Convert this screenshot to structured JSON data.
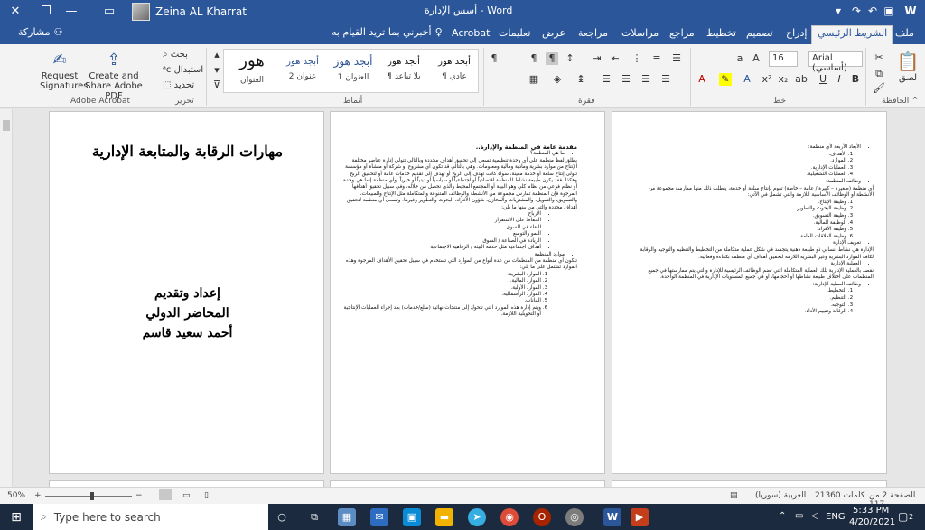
{
  "titlebar": {
    "doc_title": "أسس الإدارة  -  Word",
    "user_name": "Zeina AL Kharrat"
  },
  "tabs": {
    "items": [
      "ملف",
      "الشريط الرئيسي",
      "إدراج",
      "تصميم",
      "تخطيط",
      "مراجع",
      "مراسلات",
      "مراجعة",
      "عرض",
      "تعليمات",
      "Acrobat"
    ],
    "tell_me": "أخبرني بما تريد القيام به",
    "share": "مشاركة"
  },
  "ribbon": {
    "groups": {
      "clipboard": "الحافظة",
      "font": "خط",
      "paragraph": "فقرة",
      "styles": "أنماط",
      "editing": "تحرير",
      "acrobat": "Adobe Acrobat"
    },
    "paste": "لصق",
    "font_name": "Arial (أساسي)",
    "font_size": "16",
    "styles": [
      {
        "sample": "أبجد هوز",
        "name": "¶ عادي"
      },
      {
        "sample": "أبجد هوز",
        "name": "¶ بلا تباعد"
      },
      {
        "sample": "أبجد هوز",
        "name": "العنوان 1"
      },
      {
        "sample": "أبجد هوز",
        "name": "عنوان 2"
      },
      {
        "sample": "هور",
        "name": "العنوان"
      }
    ],
    "editing": {
      "find": "بحث",
      "replace": "استبدال",
      "select": "تحديد"
    },
    "acrobat": {
      "request": "Request Signatures",
      "create": "Create and Share Adobe PDF"
    }
  },
  "doc": {
    "cover_title": "مهارات الرقابة والمتابعة الإدارية",
    "cover_author": [
      "إعداد وتقديم",
      "المحاضر الدولي",
      "أحمد سعيد قاسم"
    ],
    "page2": {
      "heading": "مقدمة عامة في المنظمة والإدارة..",
      "q": "ما هي المنظمة؟",
      "para1": "يطلق لفظ منظمة على أي وحدة تنظيمية تسعى إلى تحقيق أهداف محددة وبالتالي تتولى إدارة عناصر مختلفة الإنتاج من موارد بشرية ومادية ومالية ومعلومات. وهي بالتالي قد تكون أي مشروع أو شركة أو منشأة أو مؤسسة تتولى إنتاج سلعة أو خدمة معينة، سواء كانت تهدف إلى الربح أو تهدف إلى تقديم خدمات عامة أو لتحقيق الربح وهكذا، فقد يكون طبيعة نشاط المنظمة اقتصادياً أو اجتماعياً أو سياسياً أو دينياً أو خيرياً. وأي منظمة إنما هي وحدة أو نظام فرعي من نظام كلي وهو البيئة أو المجتمع المحيط والذي تحصل من خلاله، وفي سبيل تحقيق أهدافها المرجوة فإن المنظمة تمارس مجموعة من الأنشطة والوظائف المتنوعة والمتكاملة مثل الإنتاج والمبيعات، والتسويق، والتمويل، والمشتريات والمخازن، شؤون الأفراد، البحوث والتطوير وغيرها. وتسعى أي منظمة لتحقيق أهداف محددة والتي من بينها ما يلي:",
      "goals": [
        "الأرباح",
        "الحفاظ على الاستقرار",
        "البقاء في السوق",
        "النمو والتوسع",
        "الريادة في الصناعة / السوق",
        "أهداف اجتماعية مثل خدمة البيئة / الرفاهية الاجتماعية"
      ],
      "resources_head": "موارد المنظمة",
      "resources_para": "تتكون أي منظمة من المنظمات من عدة أنواع من الموارد التي تستخدم في سبيل تحقيق الأهداف المرجوة وهذه الموارد تشتمل على ما يلي:",
      "resources": [
        "الموارد البشرية.",
        "الموارد المالية.",
        "الموارد الأولية.",
        "الموارد الرأسمالية.",
        "البيانات.",
        "ويتم إدارة هذه الموارد التي تتحول إلى منتجات نهائية (سلع/خدمات) بعد إجراء العمليات الإنتاجية أو التحويلية اللازمة."
      ]
    },
    "page3": {
      "pillars_head": "الأبعاد الأربعة لأي منظمة:",
      "pillars": [
        "الأهداف.",
        "الموارد.",
        "العمليات الإدارية.",
        "العمليات التشغيلية."
      ],
      "functions_head": "وظائف المنظمة:",
      "functions_para": "أي منظمة (صغيرة – كبيرة / عامة – خاصة) تقوم بإنتاج سلعة أو خدمة، يتطلب ذلك منها ممارسة مجموعة من الأنشطة أو الوظائف الأساسية اللازمة والتي تشمل في الآتي:",
      "functions": [
        "وظيفة الإنتاج.",
        "وظيفة البحوث والتطوير.",
        "وظيفة التسويق.",
        "الوظيفة المالية.",
        "وظيفة الأفراد.",
        "وظيفة العلاقات العامة."
      ],
      "def_head": "تعريف الإدارة",
      "def_para": "الإدارة هي نشاط إنساني ذو طبيعة ذهنية يتجسد في شكل عملية متكاملة من التخطيط والتنظيم والتوجيه والرقابة لكافة الموارد البشرية وغير البشرية اللازمة لتحقيق أهداف أي منظمة بكفاءة وفعالية.",
      "proc_head": "العملية الإدارية",
      "proc_para": "نقصد بالعملية الإدارية تلك العملية المتكاملة التي تضم الوظائف الرئيسية للإدارة والتي يتم ممارستها في جميع المنظمات على اختلاف طبيعة نشاطها أو أحجامها، أو في جميع المستويات الإدارية في المنظمة الواحدة.",
      "admin_head": "وظائف العملية الإدارية:",
      "admin": [
        "التخطيط.",
        "التنظيم.",
        "التوجيه.",
        "الرقابة وتقييم الأداء."
      ]
    }
  },
  "status": {
    "page": "الصفحة 2 من 117",
    "words": "21360 كلمات",
    "lang": "العربية (سوريا)",
    "zoom": "50%"
  },
  "taskbar": {
    "search_placeholder": "Type here to search",
    "time": "5:33 PM",
    "date": "4/20/2021",
    "lang": "ENG",
    "notif_count": "2"
  }
}
